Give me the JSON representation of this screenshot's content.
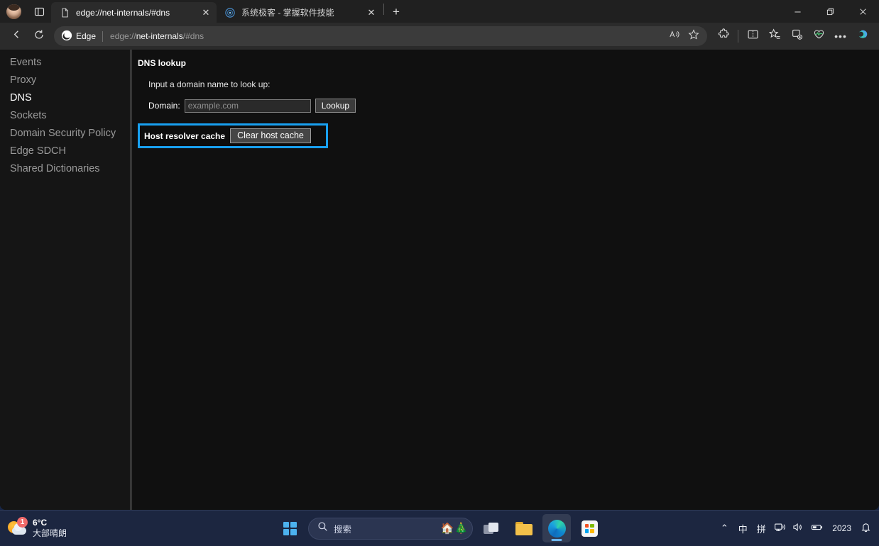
{
  "window": {
    "controls": {
      "minimize": "minimize-button",
      "restore": "restore-button",
      "close": "close-button"
    }
  },
  "tabstrip": {
    "tabs": [
      {
        "title": "edge://net-internals/#dns",
        "favicon": "page-icon",
        "active": true,
        "close_label": "✕"
      },
      {
        "title": "系统极客 - 掌握软件技能",
        "favicon": "site-favicon",
        "active": false,
        "close_label": "✕"
      }
    ],
    "new_tab_label": "+",
    "profile": "avatar",
    "tab_actions": "tab-actions-icon"
  },
  "toolbar": {
    "back": "back-arrow-icon",
    "refresh": "refresh-icon",
    "brand_label": "Edge",
    "url_prefix": "edge://",
    "url_main": "net-internals",
    "url_suffix": "/#dns",
    "read_aloud": "read-aloud-icon",
    "favorite": "star-icon",
    "extensions": "extensions-puzzle-icon",
    "split_screen": "split-screen-icon",
    "favorites_list": "favorites-icon",
    "collections": "collections-icon",
    "browser_essentials": "browser-essentials-icon",
    "more": "•••",
    "copilot": "copilot-icon"
  },
  "sidebar": {
    "items": [
      {
        "label": "Events",
        "selected": false
      },
      {
        "label": "Proxy",
        "selected": false
      },
      {
        "label": "DNS",
        "selected": true
      },
      {
        "label": "Sockets",
        "selected": false
      },
      {
        "label": "Domain Security Policy",
        "selected": false
      },
      {
        "label": "Edge SDCH",
        "selected": false
      },
      {
        "label": "Shared Dictionaries",
        "selected": false
      }
    ]
  },
  "content": {
    "section_title": "DNS lookup",
    "hint": "Input a domain name to look up:",
    "domain_label": "Domain:",
    "domain_value": "",
    "domain_placeholder": "example.com",
    "lookup_button": "Lookup",
    "cache_label": "Host resolver cache",
    "clear_cache_button": "Clear host cache",
    "highlight_color": "#18a0f0"
  },
  "taskbar": {
    "weather": {
      "temperature": "6°C",
      "description": "大部晴朗",
      "badge": "1",
      "icon": "sun-cloud-icon"
    },
    "start": "windows-start-icon",
    "search_placeholder": "搜索",
    "search_decor": [
      "🏠",
      "🎄"
    ],
    "task_view": "task-view-icon",
    "file_explorer": "file-explorer-icon",
    "edge": "edge-icon",
    "store": "microsoft-store-icon",
    "tray": {
      "overflow": "⌃",
      "ime_mode": "中",
      "ime_pinyin": "拼",
      "network": "network-icon",
      "volume": "volume-icon",
      "battery": "battery-icon",
      "year": "2023",
      "notifications": "bell-icon"
    }
  }
}
